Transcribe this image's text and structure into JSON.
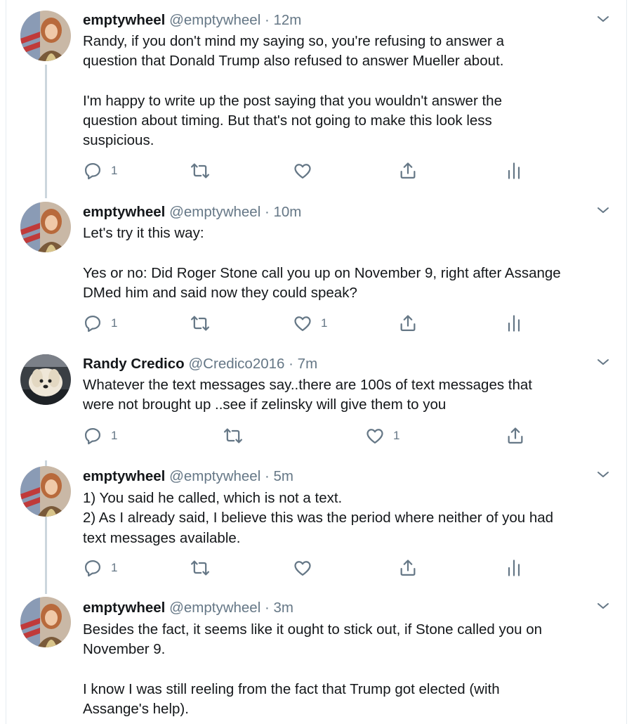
{
  "tweets": [
    {
      "display_name": "emptywheel",
      "handle": "@emptywheel",
      "separator": "·",
      "time": "12m",
      "lines": [
        "Randy, if you don't mind my saying so, you're refusing to answer a",
        "question that Donald Trump also refused to answer Mueller about.",
        "",
        "I'm happy to write up the post saying that you wouldn't answer the",
        "question about timing. But that's not going to make this look less",
        "suspicious."
      ],
      "reply_count": "1",
      "retweet_count": "",
      "like_count": "",
      "actions": [
        "reply-icon",
        "retweet-icon",
        "like-icon",
        "share-icon",
        "analytics-icon"
      ]
    },
    {
      "display_name": "emptywheel",
      "handle": "@emptywheel",
      "separator": "·",
      "time": "10m",
      "lines": [
        "Let's try it this way:",
        "",
        "Yes or no: Did Roger Stone call you up on November 9, right after Assange",
        "DMed him and said now they could speak?"
      ],
      "reply_count": "1",
      "retweet_count": "",
      "like_count": "1",
      "actions": [
        "reply-icon",
        "retweet-icon",
        "like-icon",
        "share-icon",
        "analytics-icon"
      ]
    },
    {
      "display_name": "Randy Credico",
      "handle": "@Credico2016",
      "separator": "·",
      "time": "7m",
      "lines": [
        "Whatever the text messages say..there are 100s of text messages that",
        "were not brought up ..see if zelinsky will give them to you"
      ],
      "reply_count": "1",
      "retweet_count": "",
      "like_count": "1",
      "actions": [
        "reply-icon",
        "retweet-icon",
        "like-icon",
        "share-icon"
      ]
    },
    {
      "display_name": "emptywheel",
      "handle": "@emptywheel",
      "separator": "·",
      "time": "5m",
      "lines": [
        "1) You said he called, which is not a text.",
        "2) As I already said, I believe this was the period where neither of you had",
        "text messages available."
      ],
      "reply_count": "1",
      "retweet_count": "",
      "like_count": "",
      "actions": [
        "reply-icon",
        "retweet-icon",
        "like-icon",
        "share-icon",
        "analytics-icon"
      ]
    },
    {
      "display_name": "emptywheel",
      "handle": "@emptywheel",
      "separator": "·",
      "time": "3m",
      "lines": [
        "Besides the fact, it seems like it ought to stick out, if Stone called you on",
        "November 9.",
        "",
        "I know I was still reeling from the fact that Trump got elected (with",
        "Assange's help)."
      ],
      "reply_count": "",
      "retweet_count": "",
      "like_count": "",
      "actions": []
    }
  ],
  "colors": {
    "text": "#14171a",
    "secondary": "#657786",
    "thread_line": "#ccd6dd",
    "divider": "#e6ecf0"
  }
}
